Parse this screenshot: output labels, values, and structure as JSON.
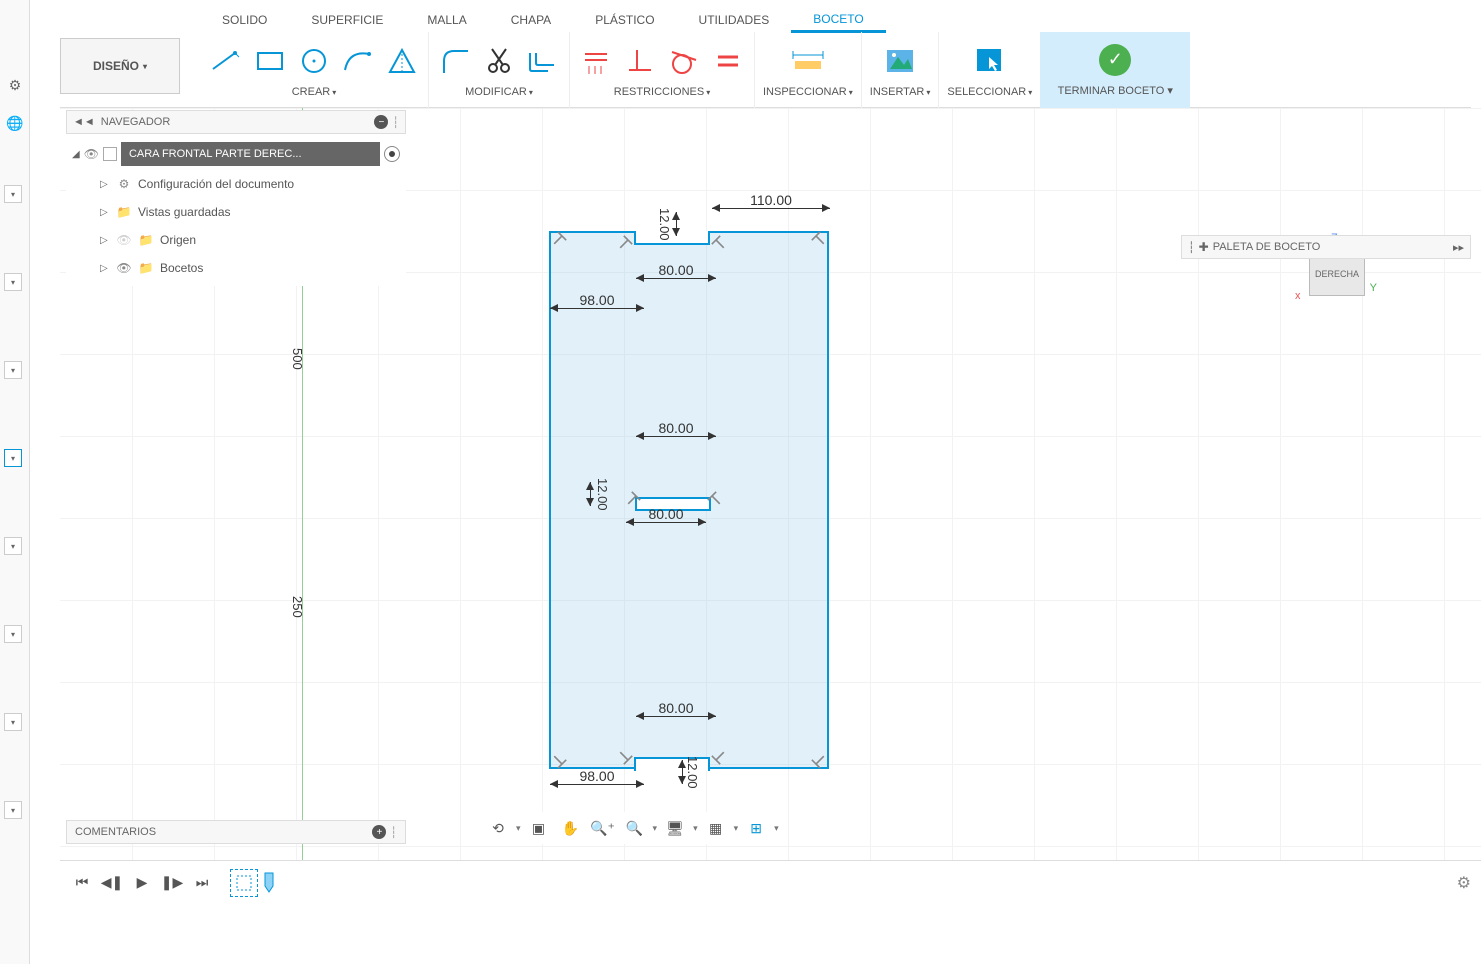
{
  "toolbar": {
    "design_label": "DISEÑO",
    "tabs": [
      "SOLIDO",
      "SUPERFICIE",
      "MALLA",
      "CHAPA",
      "PLÁSTICO",
      "UTILIDADES",
      "BOCETO"
    ],
    "active_tab": "BOCETO",
    "groups": {
      "create": "CREAR",
      "modify": "MODIFICAR",
      "constraints": "RESTRICCIONES",
      "inspect": "INSPECCIONAR",
      "insert": "INSERTAR",
      "select": "SELECCIONAR",
      "finish": "TERMINAR BOCETO"
    }
  },
  "navigator": {
    "title": "NAVEGADOR",
    "doc_title": "CARA FRONTAL PARTE DEREC...",
    "items": [
      {
        "label": "Configuración del documento"
      },
      {
        "label": "Vistas guardadas"
      },
      {
        "label": "Origen"
      },
      {
        "label": "Bocetos"
      }
    ]
  },
  "comments": {
    "title": "COMENTARIOS"
  },
  "sketch_palette": {
    "title": "PALETA DE BOCETO"
  },
  "view_cube": {
    "face": "DERECHA",
    "z": "Z",
    "y": "Y",
    "x": "x"
  },
  "axis_labels": {
    "l1": "500",
    "l2": "250"
  },
  "dimensions": {
    "d110": "110.00",
    "d12a": "12.00",
    "d80a": "80.00",
    "d98a": "98.00",
    "d80b": "80.00",
    "d12b": "12.00",
    "d80c": "80.00",
    "d80d": "80.00",
    "d98b": "98.00",
    "d12c": "12.00"
  }
}
